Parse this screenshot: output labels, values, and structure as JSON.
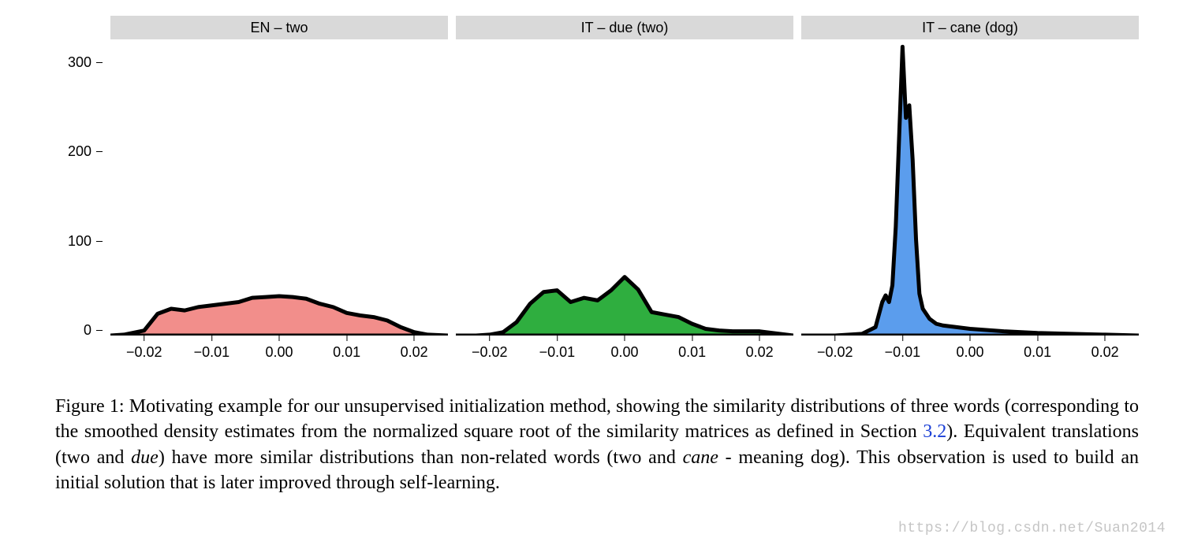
{
  "chart_data": [
    {
      "type": "area",
      "title": "EN – two",
      "color_fill": "#f28e8b",
      "color_stroke": "#000000",
      "xlim": [
        -0.025,
        0.025
      ],
      "ylim": [
        0,
        350
      ],
      "x_ticks": [
        -0.02,
        -0.01,
        0.0,
        0.01,
        0.02
      ],
      "y_ticks": [
        0,
        100,
        200,
        300
      ],
      "x": [
        -0.025,
        -0.023,
        -0.02,
        -0.018,
        -0.016,
        -0.014,
        -0.012,
        -0.01,
        -0.008,
        -0.006,
        -0.004,
        -0.002,
        0.0,
        0.002,
        0.004,
        0.006,
        0.008,
        0.01,
        0.012,
        0.014,
        0.016,
        0.018,
        0.02,
        0.022,
        0.025
      ],
      "y": [
        0,
        1,
        6,
        26,
        32,
        30,
        34,
        36,
        38,
        40,
        45,
        46,
        47,
        46,
        44,
        38,
        34,
        27,
        24,
        22,
        18,
        10,
        4,
        1,
        0
      ]
    },
    {
      "type": "area",
      "title": "IT – due (two)",
      "color_fill": "#2fae3f",
      "color_stroke": "#000000",
      "xlim": [
        -0.025,
        0.025
      ],
      "ylim": [
        0,
        350
      ],
      "x_ticks": [
        -0.02,
        -0.01,
        0.0,
        0.01,
        0.02
      ],
      "y_ticks": [
        0,
        100,
        200,
        300
      ],
      "x": [
        -0.025,
        -0.022,
        -0.02,
        -0.018,
        -0.016,
        -0.014,
        -0.012,
        -0.01,
        -0.008,
        -0.006,
        -0.004,
        -0.002,
        0.0,
        0.002,
        0.004,
        0.006,
        0.008,
        0.01,
        0.012,
        0.014,
        0.016,
        0.018,
        0.02,
        0.022,
        0.025
      ],
      "y": [
        0,
        0,
        1,
        4,
        16,
        38,
        52,
        54,
        40,
        45,
        42,
        54,
        70,
        55,
        28,
        25,
        22,
        14,
        8,
        6,
        5,
        5,
        5,
        3,
        0
      ]
    },
    {
      "type": "area",
      "title": "IT – cane (dog)",
      "color_fill": "#5b9ded",
      "color_stroke": "#000000",
      "xlim": [
        -0.025,
        0.025
      ],
      "ylim": [
        0,
        350
      ],
      "x_ticks": [
        -0.02,
        -0.01,
        0.0,
        0.01,
        0.02
      ],
      "y_ticks": [
        0,
        100,
        200,
        300
      ],
      "x": [
        -0.025,
        -0.02,
        -0.016,
        -0.014,
        -0.013,
        -0.0125,
        -0.012,
        -0.0115,
        -0.011,
        -0.01,
        -0.0095,
        -0.009,
        -0.0085,
        -0.008,
        -0.0075,
        -0.007,
        -0.006,
        -0.005,
        -0.004,
        -0.002,
        0.0,
        0.005,
        0.01,
        0.015,
        0.02,
        0.025
      ],
      "y": [
        0,
        0,
        2,
        10,
        40,
        48,
        40,
        60,
        130,
        345,
        260,
        275,
        210,
        115,
        50,
        32,
        20,
        14,
        12,
        10,
        8,
        5,
        3,
        2,
        1,
        0
      ]
    }
  ],
  "axis": {
    "y_tick_labels": [
      "0",
      "100",
      "200",
      "300"
    ],
    "x_tick_labels": [
      "−0.02",
      "−0.01",
      "0.00",
      "0.01",
      "0.02"
    ]
  },
  "caption": {
    "fig_label": "Figure 1: ",
    "part1": "Motivating example for our unsupervised initialization method, showing the similarity distributions of three words (corresponding to the smoothed density estimates from the normalized square root of the similarity matrices as defined in Section ",
    "section_ref": "3.2",
    "part2": "). Equivalent translations (two and ",
    "em1": "due",
    "part3": ") have more similar distributions than non-related words (two and ",
    "em2": "cane",
    "part4": " - meaning dog). This observation is used to build an initial solution that is later improved through self-learning."
  },
  "watermark": "https://blog.csdn.net/Suan2014"
}
